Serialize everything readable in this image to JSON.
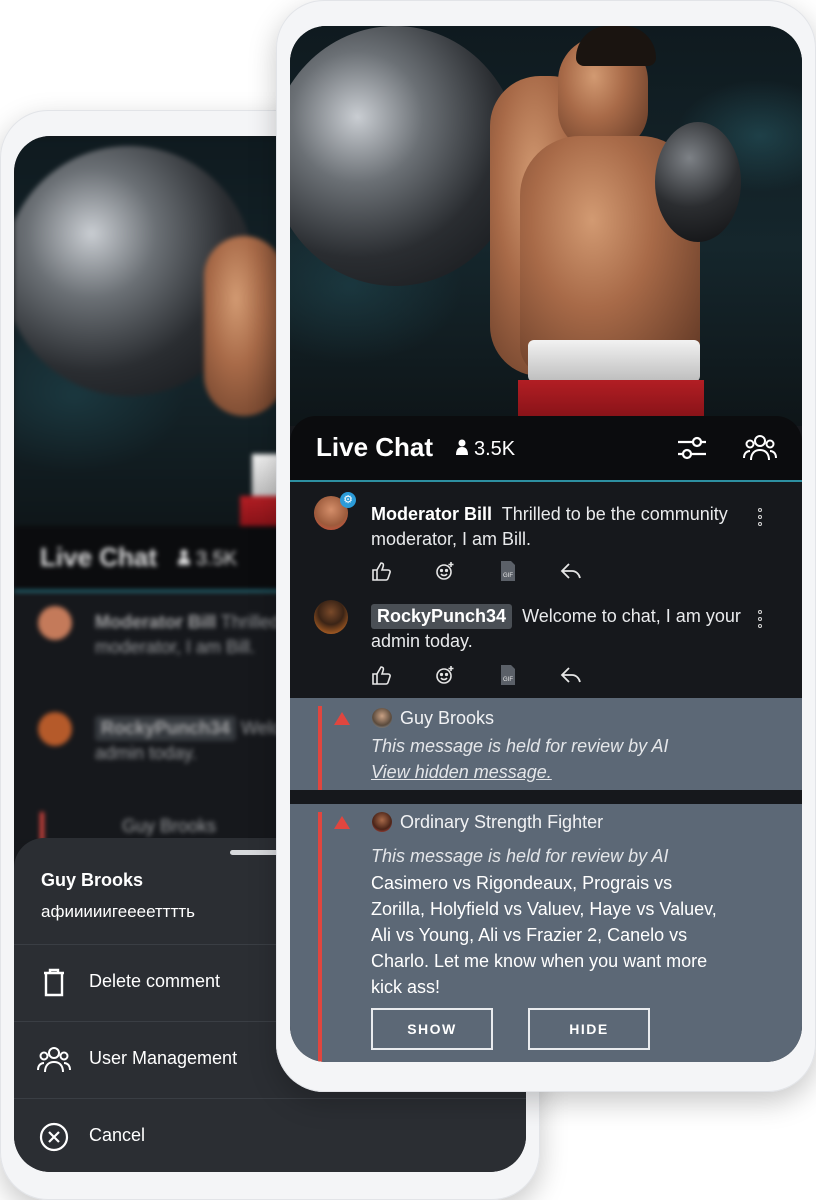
{
  "chat": {
    "title": "Live Chat",
    "viewers": "3.5K"
  },
  "messages": [
    {
      "user": "Moderator Bill",
      "text": "Thrilled to be the community moderator, I am Bill."
    },
    {
      "user": "RockyPunch34",
      "text": "Welcome to chat, I am your admin today."
    }
  ],
  "held_messages": [
    {
      "user": "Guy Brooks",
      "note": "This message is held for review by AI",
      "link": "View hidden message."
    },
    {
      "user": "Ordinary Strength Fighter",
      "note": "This message is held for review by AI",
      "body": "Casimero vs Rigondeaux, Prograis vs Zorilla, Holyfield vs Valuev, Haye vs Valuev, Ali vs Young, Ali vs Frazier 2, Canelo vs Charlo. Let me know when you want more kick ass!",
      "show_label": "SHOW",
      "hide_label": "HIDE"
    }
  ],
  "sheet": {
    "user": "Guy Brooks",
    "text": "афииииигеееетттть",
    "items": [
      {
        "label": "Delete comment",
        "icon": "trash-icon"
      },
      {
        "label": "User Management",
        "icon": "users-icon"
      },
      {
        "label": "Cancel",
        "icon": "cancel-circle-icon"
      }
    ]
  },
  "colors": {
    "accent": "#2d8fa1",
    "held_bg": "#5c6876",
    "warning": "#e0463f",
    "badge": "#2b9bd8"
  }
}
